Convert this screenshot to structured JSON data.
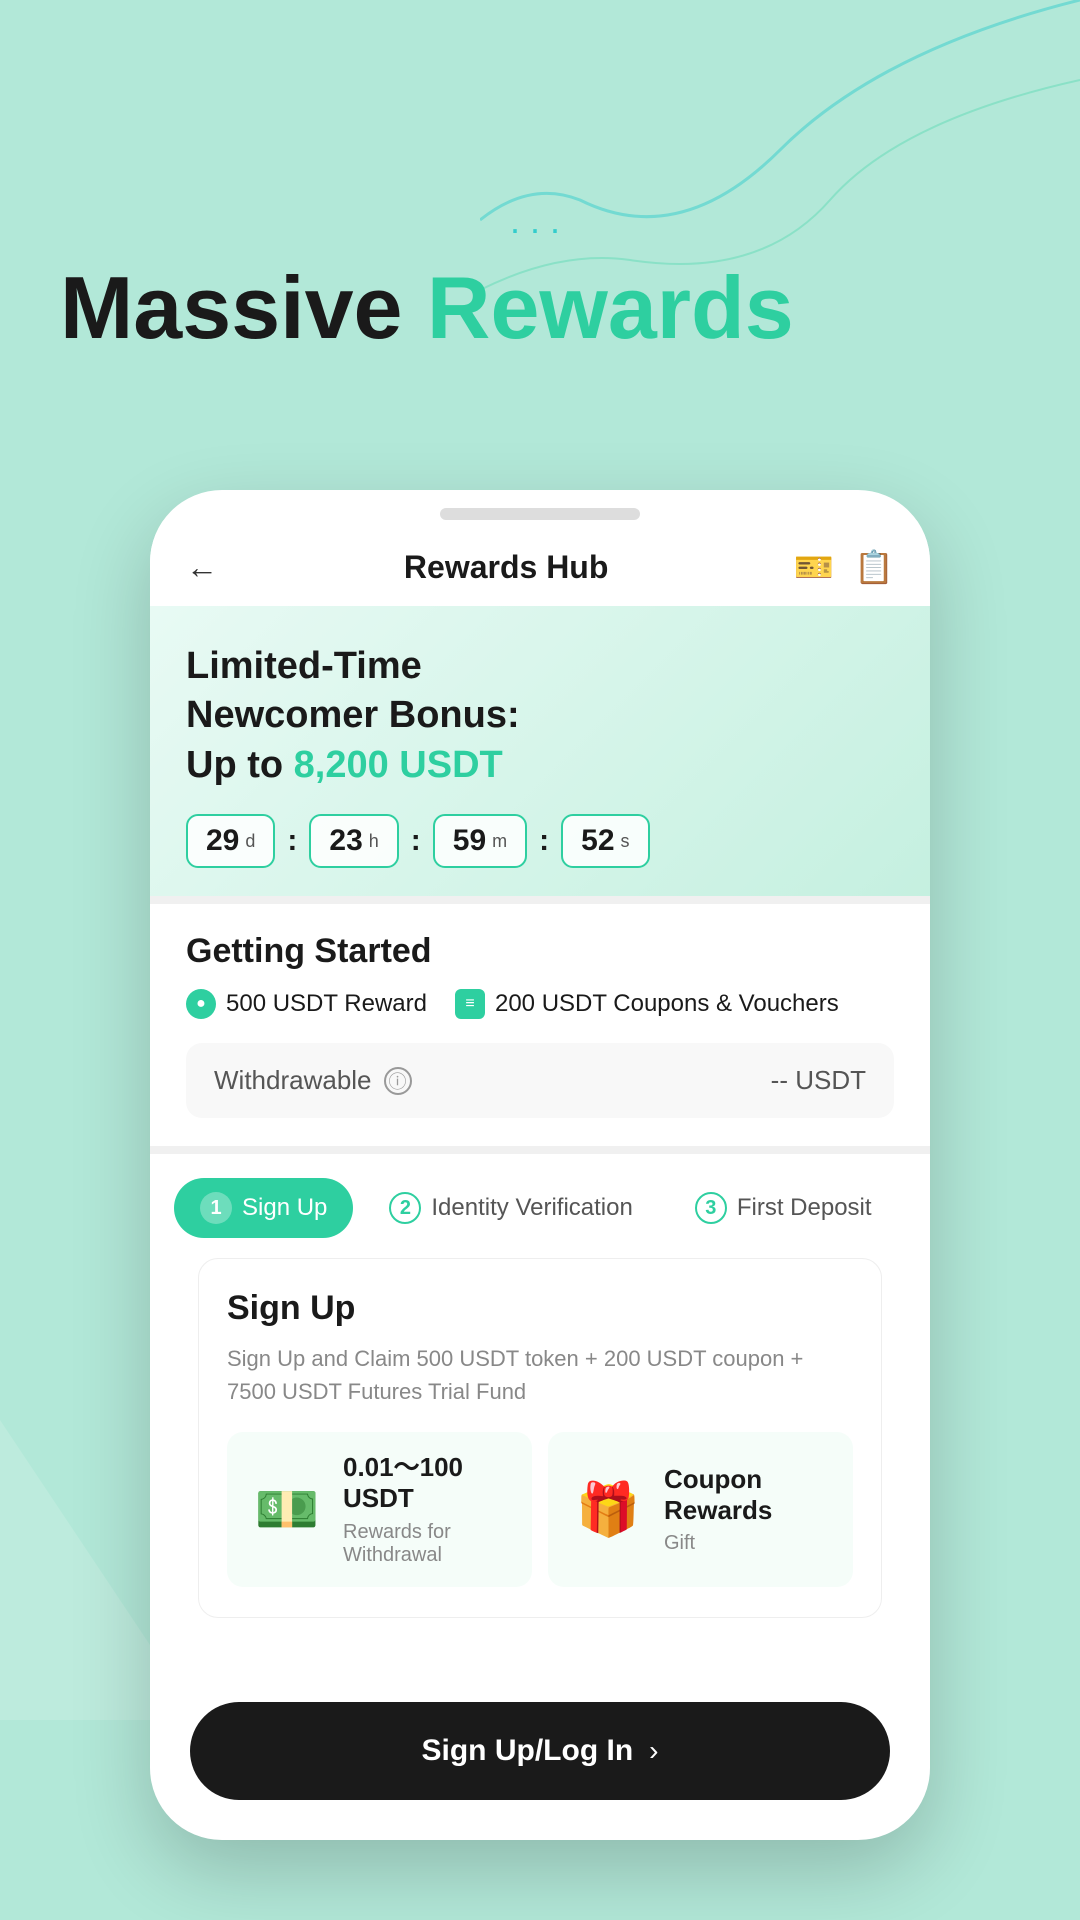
{
  "page": {
    "bg_color": "#b2e8d8",
    "accent_color": "#2ecfa0"
  },
  "headline": {
    "part1": "Massive ",
    "part2": "Rewards"
  },
  "dots": "...",
  "header": {
    "title": "Rewards Hub",
    "back_icon": "←",
    "coupon_icon": "🎫",
    "clipboard_icon": "📋"
  },
  "banner": {
    "title_line1": "Limited-Time",
    "title_line2": "Newcomer Bonus:",
    "title_line3": "Up to ",
    "amount": "8,200 USDT",
    "timer": {
      "days": "29",
      "days_unit": "d",
      "hours": "23",
      "hours_unit": "h",
      "minutes": "59",
      "minutes_unit": "m",
      "seconds": "52",
      "seconds_unit": "s"
    }
  },
  "getting_started": {
    "title": "Getting Started",
    "reward1": "500 USDT Reward",
    "reward2": "200 USDT Coupons & Vouchers",
    "withdrawable_label": "Withdrawable",
    "withdrawable_value": "-- USDT"
  },
  "steps": [
    {
      "num": "1",
      "label": "Sign Up",
      "active": true
    },
    {
      "num": "2",
      "label": "Identity Verification",
      "active": false
    },
    {
      "num": "3",
      "label": "First Deposit",
      "active": false
    }
  ],
  "signup_card": {
    "title": "Sign Up",
    "description": "Sign Up and Claim 500 USDT token + 200 USDT coupon + 7500 USDT Futures Trial Fund",
    "reward1": {
      "icon": "💵",
      "amount": "0.01～100\nUSDT",
      "label": "Rewards for Withdrawal"
    },
    "reward2": {
      "icon": "🎁",
      "title": "Coupon\nRewards",
      "label": "Gift"
    }
  },
  "bottom_button": {
    "label": "Sign Up/Log In",
    "arrow": "›"
  }
}
